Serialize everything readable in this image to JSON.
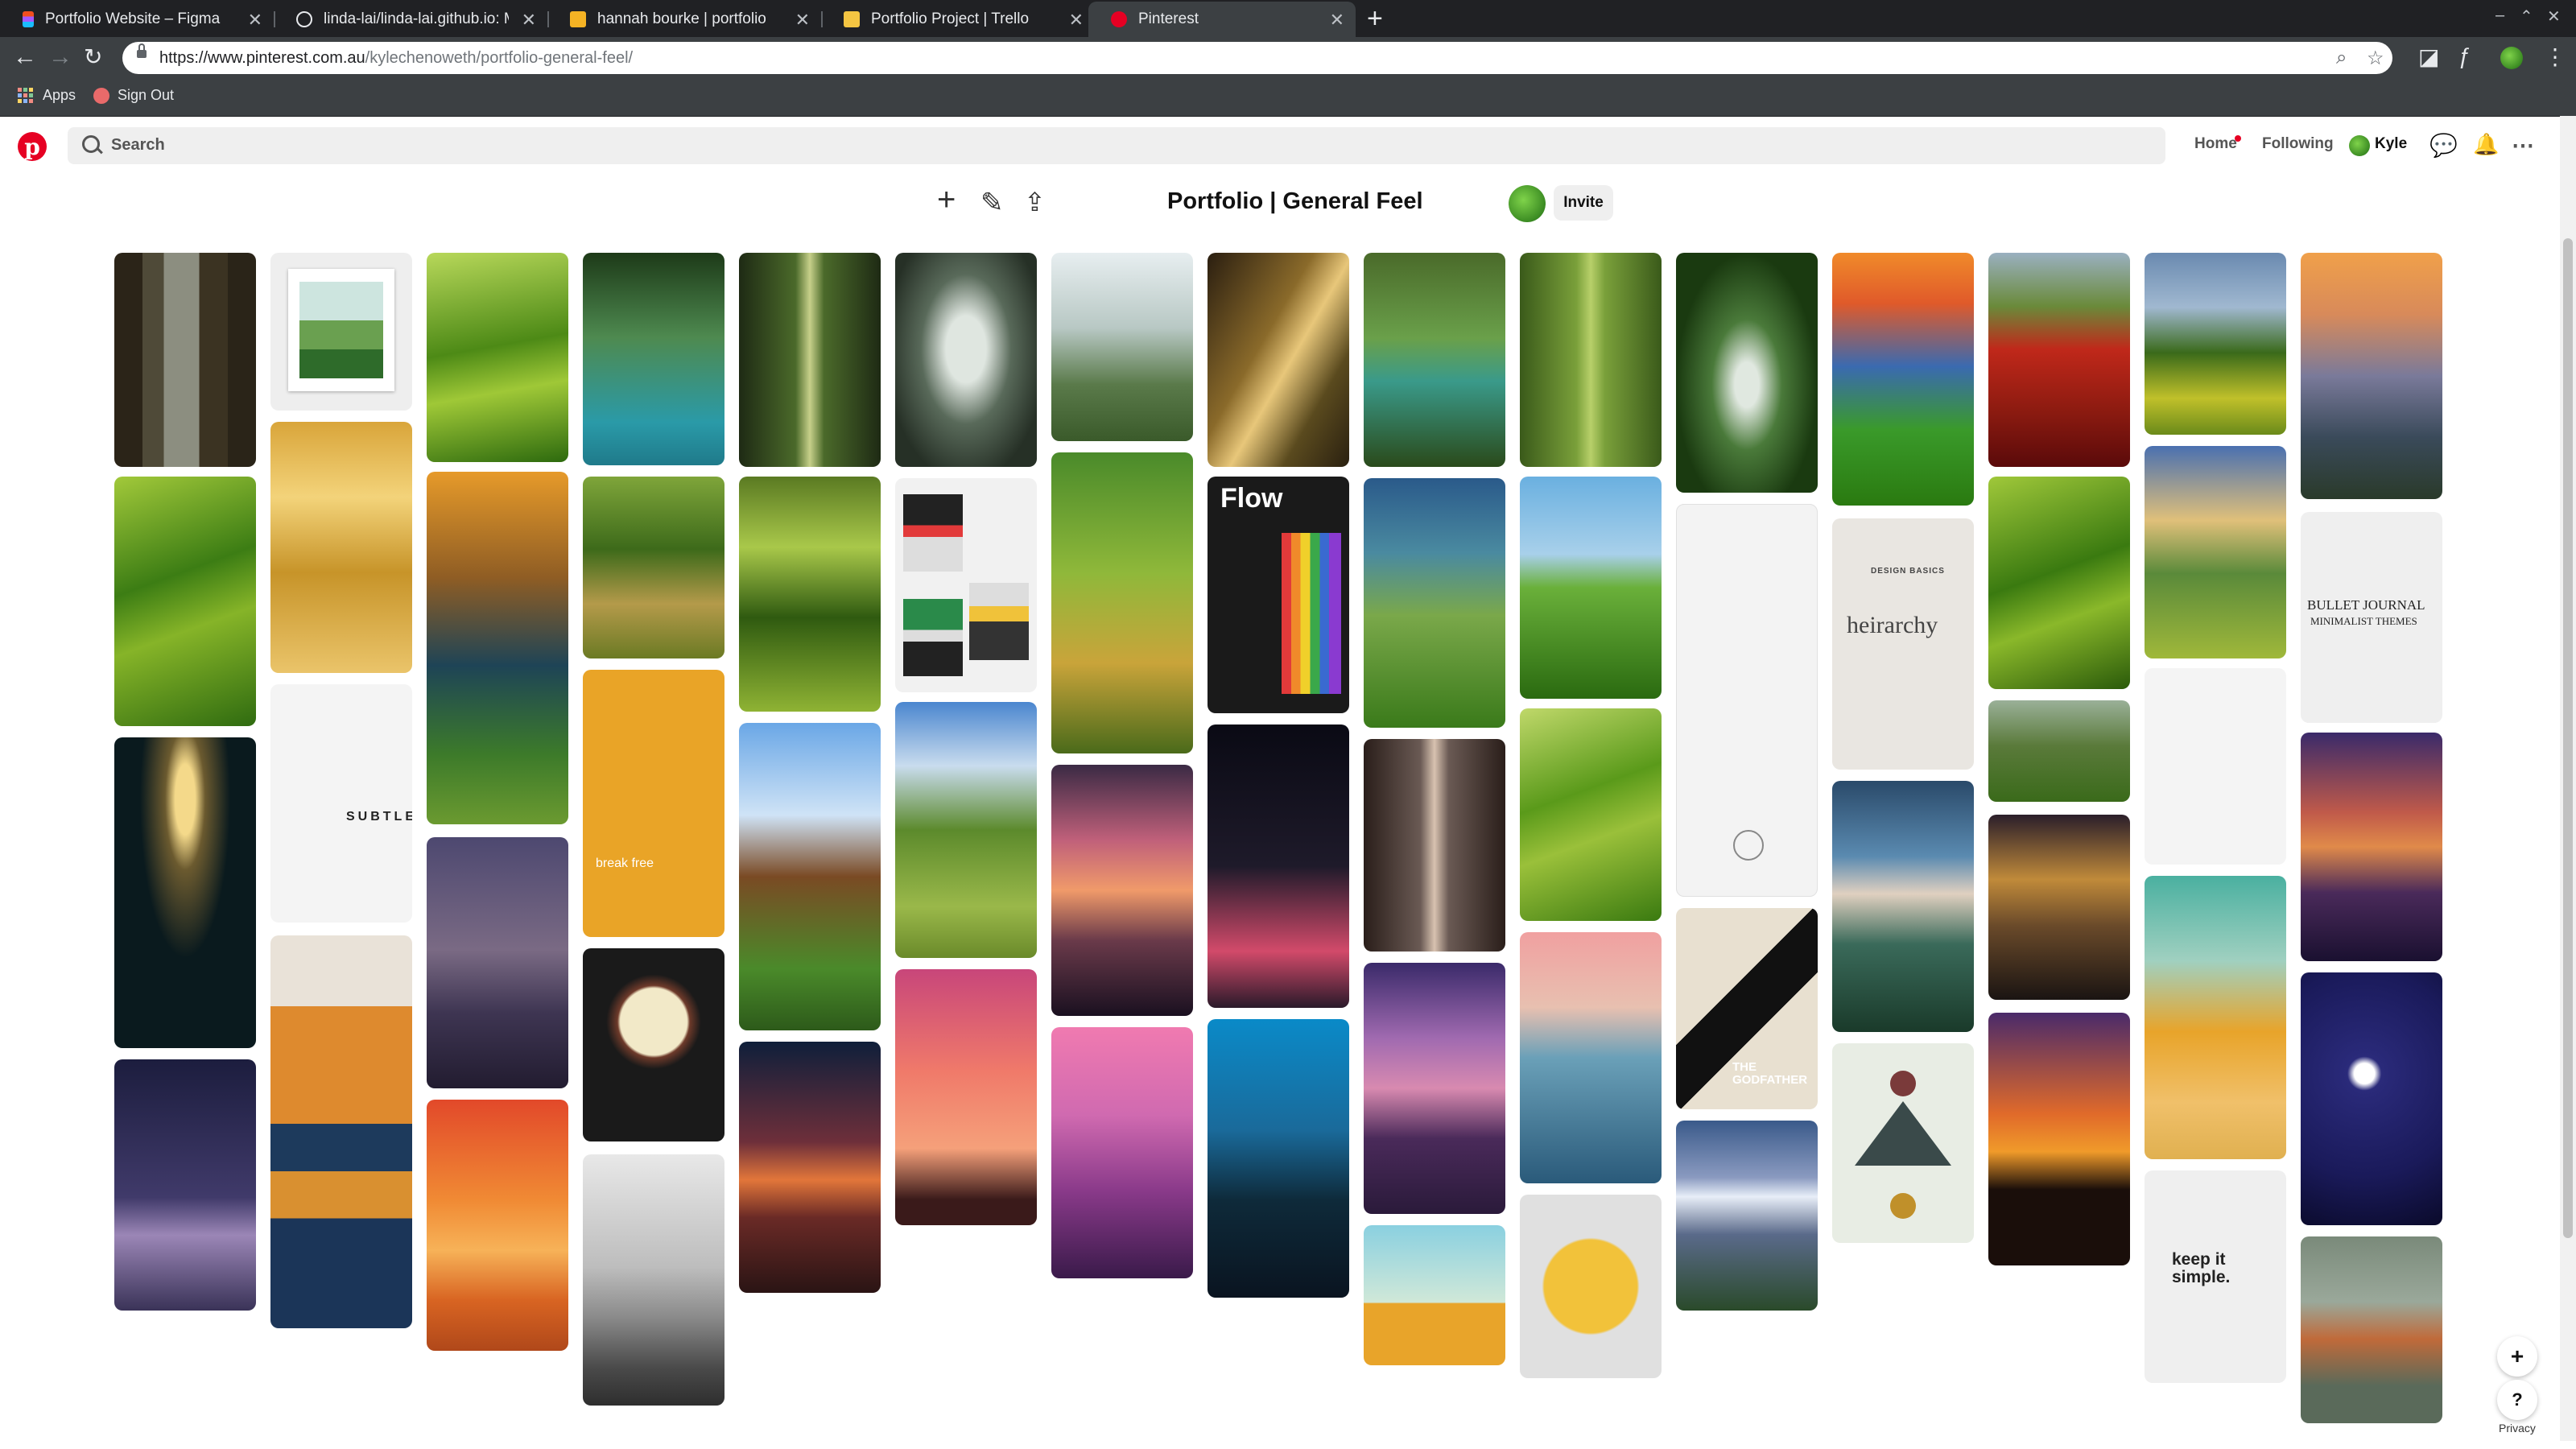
{
  "browser": {
    "tabs": [
      {
        "title": "Portfolio Website – Figma",
        "icon": "figma-icon",
        "color": "#f24e1e"
      },
      {
        "title": "linda-lai/linda-lai.github.io: My",
        "icon": "github-icon",
        "color": "#e8eaed"
      },
      {
        "title": "hannah bourke | portfolio",
        "icon": "hb-icon",
        "color": "#f5b324"
      },
      {
        "title": "Portfolio Project | Trello",
        "icon": "trello-icon",
        "color": "#f4c542"
      },
      {
        "title": "Pinterest",
        "icon": "pinterest-icon",
        "color": "#e60023"
      }
    ],
    "url_host": "https://www.pinterest.com.au",
    "url_path": "/kylechenoweth/portfolio-general-feel/",
    "bookmarks": [
      {
        "label": "Apps",
        "icon": "apps-grid-icon"
      },
      {
        "label": "Sign Out",
        "icon": "signout-icon"
      }
    ]
  },
  "header": {
    "search_placeholder": "Search",
    "nav_home": "Home",
    "nav_following": "Following",
    "user_name": "Kyle"
  },
  "board": {
    "title": "Portfolio | General Feel",
    "invite_label": "Invite"
  },
  "pin_texts": {
    "subtle": "SUBTLE",
    "breakfree": "break free",
    "flow": "Flow",
    "heirarchy": "heirarchy",
    "design_basics": "DESIGN BASICS",
    "bullet_journal": "BULLET JOURNAL",
    "minimalist_themes": "MINIMALIST THEMES",
    "the_godfather": "THE GODFATHER",
    "keep_it_simple": "keep it simple."
  },
  "footer": {
    "add_label": "+",
    "help_label": "?",
    "privacy_label": "Privacy"
  }
}
